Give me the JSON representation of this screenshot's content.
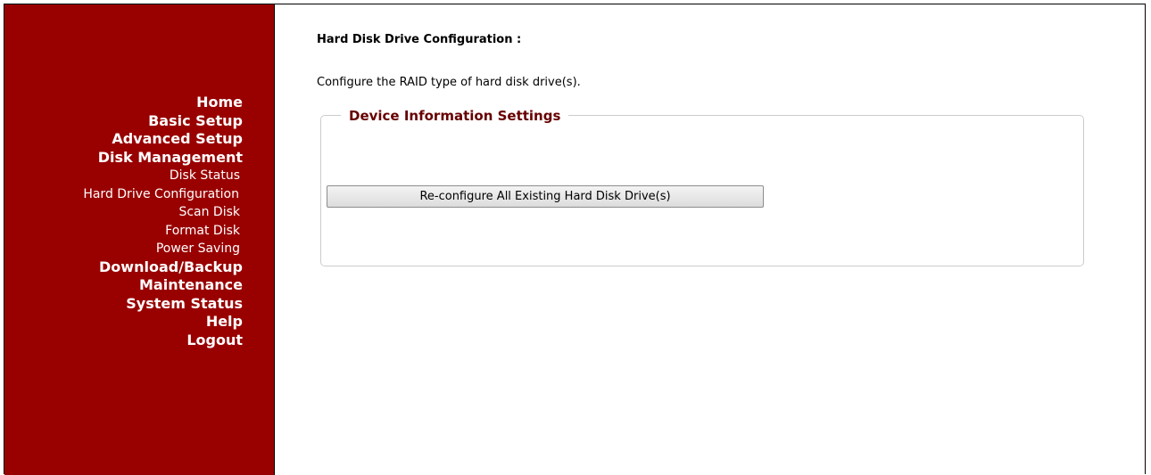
{
  "sidebar": {
    "nav": [
      {
        "label": "Home",
        "type": "main"
      },
      {
        "label": "Basic Setup",
        "type": "main"
      },
      {
        "label": "Advanced Setup",
        "type": "main"
      },
      {
        "label": "Disk Management",
        "type": "main"
      },
      {
        "label": "Disk Status",
        "type": "sub"
      },
      {
        "label": "Hard Drive Configuration",
        "type": "sub"
      },
      {
        "label": "Scan Disk",
        "type": "sub"
      },
      {
        "label": "Format Disk",
        "type": "sub"
      },
      {
        "label": "Power Saving",
        "type": "sub"
      },
      {
        "label": "Download/Backup",
        "type": "main"
      },
      {
        "label": "Maintenance",
        "type": "main"
      },
      {
        "label": "System Status",
        "type": "main"
      },
      {
        "label": "Help",
        "type": "main"
      },
      {
        "label": "Logout",
        "type": "main"
      }
    ]
  },
  "main": {
    "title": "Hard Disk Drive Configuration :",
    "description": "Configure the RAID type of hard disk drive(s).",
    "section": {
      "legend": "Device Information Settings",
      "button_label": "Re-configure All Existing Hard Disk Drive(s)"
    }
  },
  "colors": {
    "sidebar_bg": "#990000",
    "legend_text": "#660000"
  }
}
